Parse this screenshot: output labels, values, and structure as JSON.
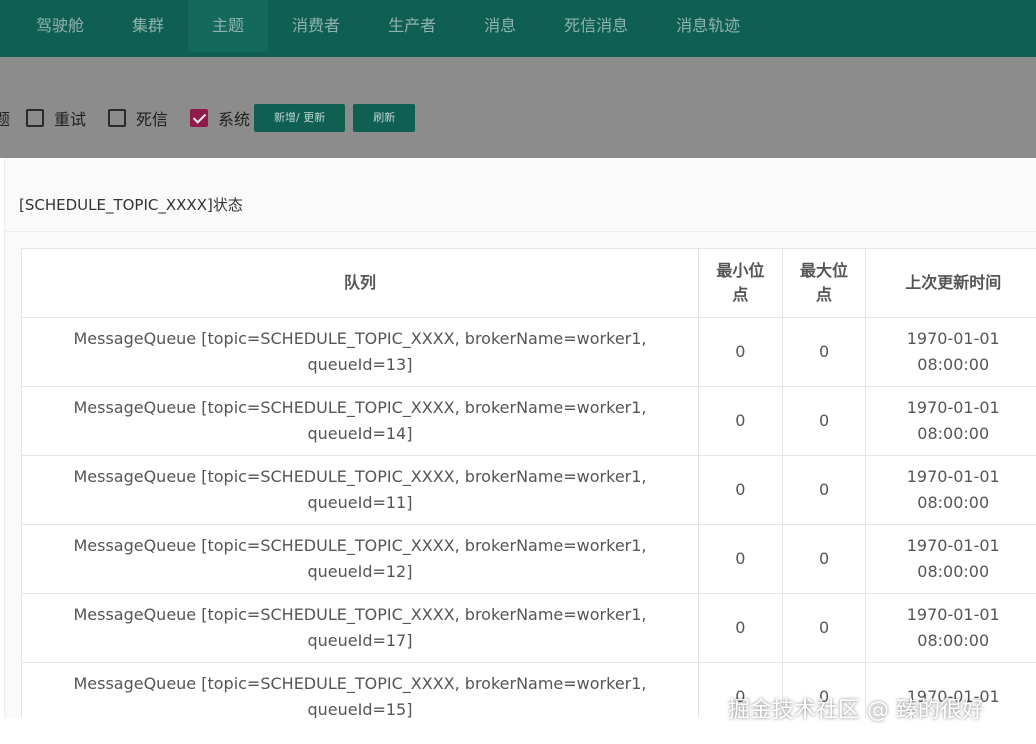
{
  "nav": {
    "items": [
      "驾驶舱",
      "集群",
      "主题",
      "消费者",
      "生产者",
      "消息",
      "死信消息",
      "消息轨迹"
    ],
    "active_index": 2
  },
  "toolbar": {
    "cut_label": "题",
    "checkboxes": [
      {
        "label": "重试",
        "checked": false
      },
      {
        "label": "死信",
        "checked": false
      },
      {
        "label": "系统",
        "checked": true
      }
    ],
    "buttons": [
      "新增/ 更新",
      "刷新"
    ]
  },
  "panel": {
    "title": "[SCHEDULE_TOPIC_XXXX]状态"
  },
  "table": {
    "headers": [
      "队列",
      "最小位点",
      "最大位点",
      "上次更新时间"
    ],
    "rows": [
      {
        "queue": "MessageQueue [topic=SCHEDULE_TOPIC_XXXX, brokerName=worker1, queueId=13]",
        "min": "0",
        "max": "0",
        "time": "1970-01-01 08:00:00"
      },
      {
        "queue": "MessageQueue [topic=SCHEDULE_TOPIC_XXXX, brokerName=worker1, queueId=14]",
        "min": "0",
        "max": "0",
        "time": "1970-01-01 08:00:00"
      },
      {
        "queue": "MessageQueue [topic=SCHEDULE_TOPIC_XXXX, brokerName=worker1, queueId=11]",
        "min": "0",
        "max": "0",
        "time": "1970-01-01 08:00:00"
      },
      {
        "queue": "MessageQueue [topic=SCHEDULE_TOPIC_XXXX, brokerName=worker1, queueId=12]",
        "min": "0",
        "max": "0",
        "time": "1970-01-01 08:00:00"
      },
      {
        "queue": "MessageQueue [topic=SCHEDULE_TOPIC_XXXX, brokerName=worker1, queueId=17]",
        "min": "0",
        "max": "0",
        "time": "1970-01-01 08:00:00"
      },
      {
        "queue": "MessageQueue [topic=SCHEDULE_TOPIC_XXXX, brokerName=worker1, queueId=15]",
        "min": "0",
        "max": "0",
        "time": "1970-01-01"
      }
    ]
  },
  "watermark": "掘金技术社区 @ 臻的很好",
  "colors": {
    "nav_bg": "#0f5f52",
    "overlay": "#8c8c8c",
    "checkbox_checked": "#8e1b4c"
  }
}
